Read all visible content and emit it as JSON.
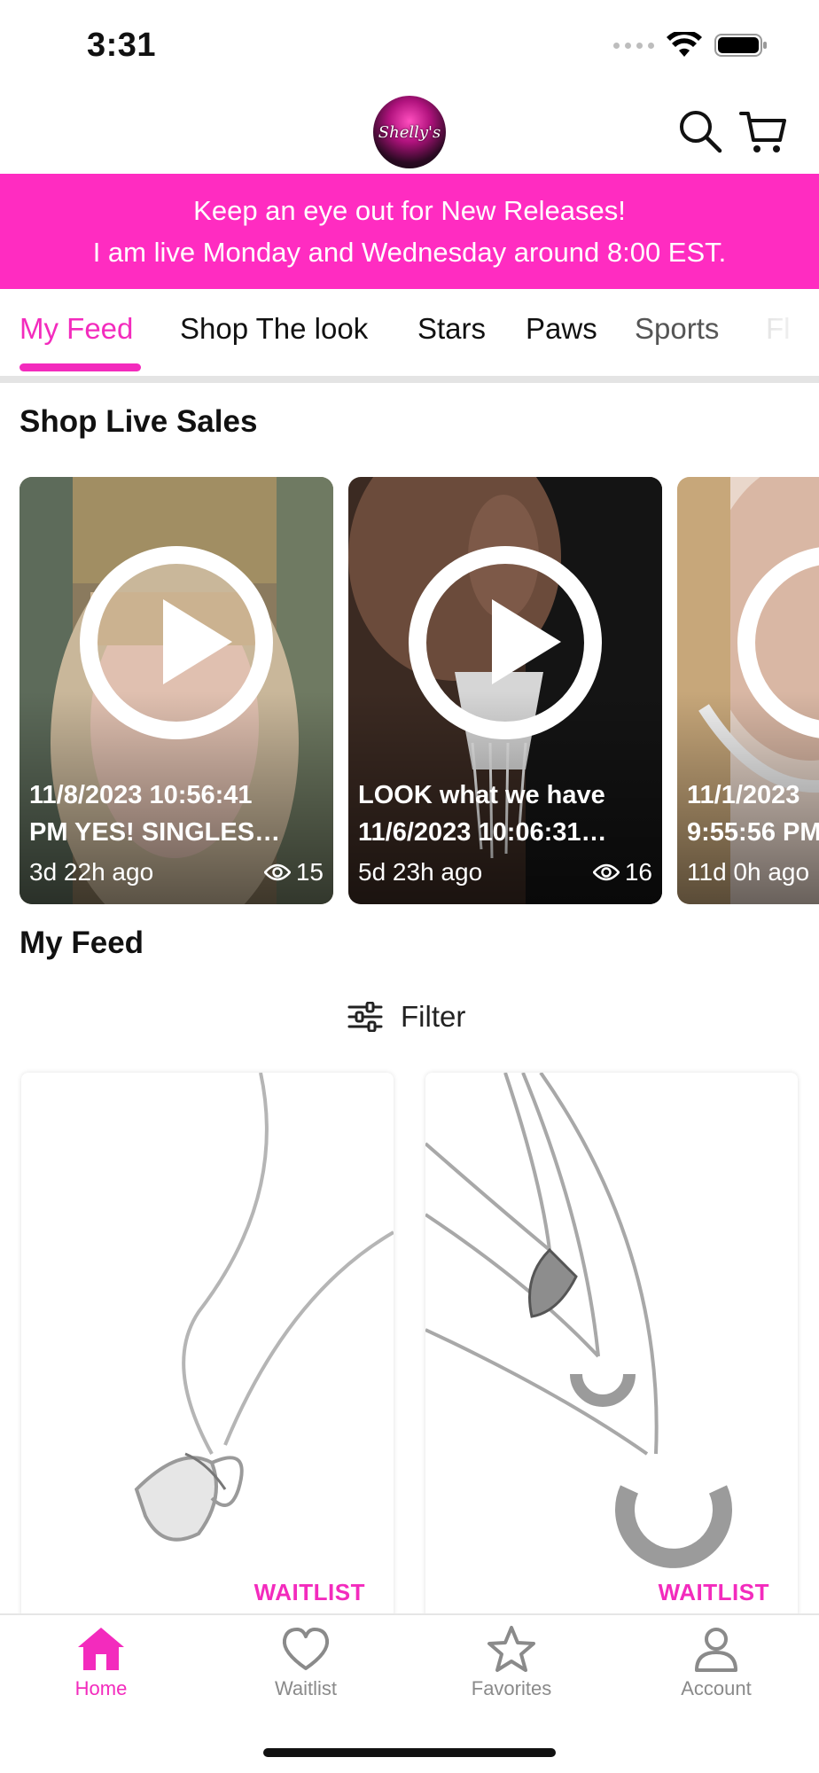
{
  "status": {
    "time": "3:31"
  },
  "header": {
    "logo_text": "Shelly's"
  },
  "banner": {
    "line1": "Keep an eye out for New Releases!",
    "line2": "I am live Monday and Wednesday around 8:00 EST."
  },
  "tabs": [
    {
      "label": "My Feed",
      "active": true
    },
    {
      "label": "Shop The look"
    },
    {
      "label": "Stars"
    },
    {
      "label": "Paws"
    },
    {
      "label": "Sports"
    },
    {
      "label": "Fl"
    }
  ],
  "live_section": {
    "title": "Shop Live Sales",
    "cards": [
      {
        "title": "11/8/2023 10:56:41\nPM  YES!  SINGLES…",
        "age": "3d 22h ago",
        "views": "15"
      },
      {
        "title": "LOOK what we have\n11/6/2023 10:06:31…",
        "age": "5d 23h ago",
        "views": "16"
      },
      {
        "title": "11/1/2023\n9:55:56 PM",
        "age": "11d 0h ago",
        "views": ""
      }
    ]
  },
  "feed": {
    "title": "My Feed",
    "filter_label": "Filter",
    "products": [
      {
        "badge": "WAITLIST"
      },
      {
        "badge": "WAITLIST"
      }
    ]
  },
  "bottom_nav": [
    {
      "label": "Home",
      "active": true
    },
    {
      "label": "Waitlist"
    },
    {
      "label": "Favorites"
    },
    {
      "label": "Account"
    }
  ],
  "colors": {
    "accent": "#f32bbd",
    "banner": "#ff2cc1",
    "nav_inactive": "#8a8a8a"
  }
}
